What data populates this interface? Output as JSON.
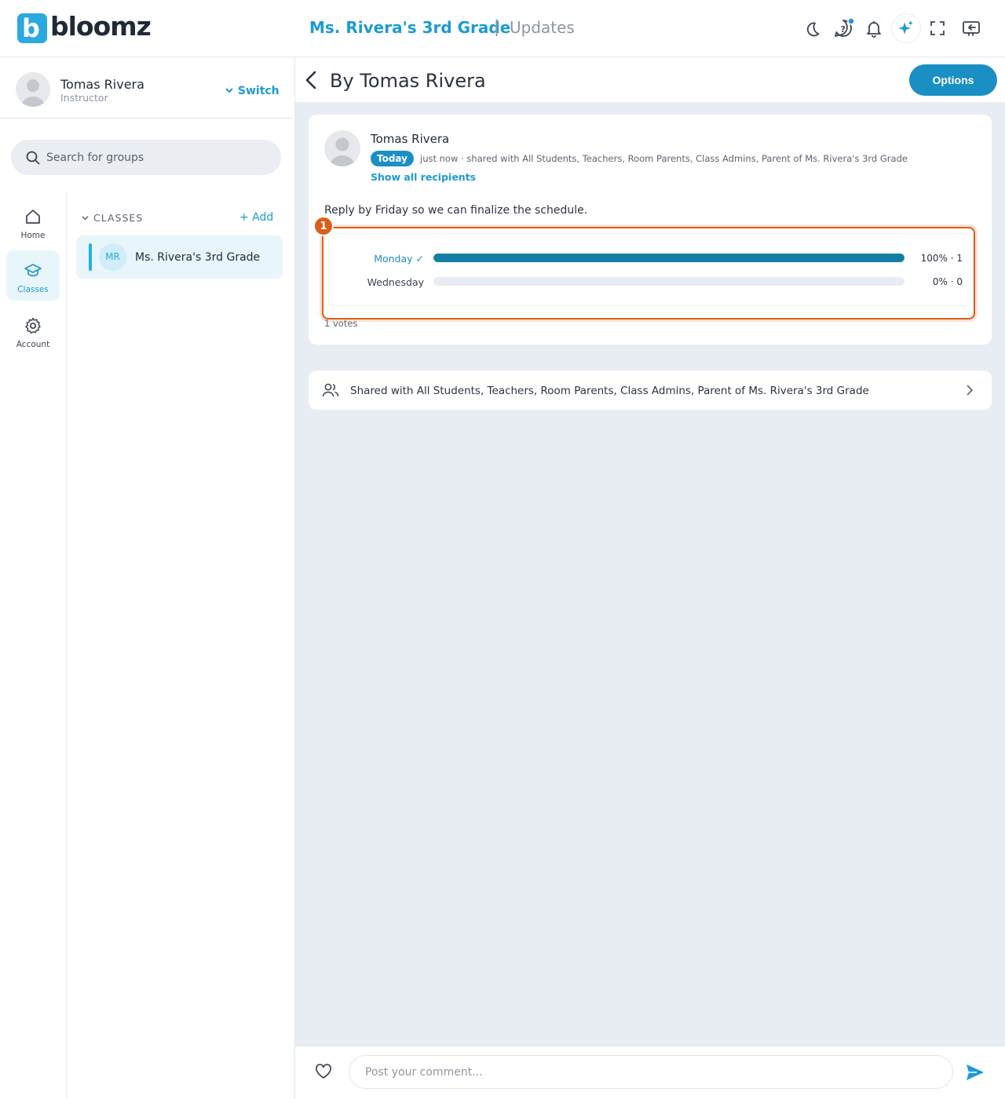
{
  "brand": {
    "logo_letter": "b",
    "name": "bloomz"
  },
  "header": {
    "class_title": "Ms. Rivera's 3rd Grade",
    "separator": "|",
    "section": "Updates",
    "accent_color": "#1c9bd1"
  },
  "user": {
    "name": "Tomas Rivera",
    "role": "Instructor",
    "switch_label": "Switch"
  },
  "search": {
    "placeholder": "Search for groups"
  },
  "nav": [
    {
      "label": "Home",
      "icon": "home-icon"
    },
    {
      "label": "Classes",
      "icon": "graduation-cap-icon",
      "active": true
    },
    {
      "label": "Account",
      "icon": "gear-icon"
    }
  ],
  "classes": {
    "heading": "CLASSES",
    "add_label": "+ Add",
    "items": [
      {
        "initials": "MR",
        "name": "Ms. Rivera's 3rd Grade"
      }
    ]
  },
  "page": {
    "title": "By Tomas Rivera",
    "options_label": "Options"
  },
  "post": {
    "author": "Tomas Rivera",
    "badge": "Today",
    "meta": "just now · shared with All Students, Teachers, Room Parents, Class Admins, Parent of Ms. Rivera's 3rd Grade",
    "show_all": "Show all recipients",
    "message": "Reply by Friday so we can finalize the schedule.",
    "poll": {
      "options": [
        {
          "label": "Monday ✓",
          "percent": 100,
          "pct_text": "100% · 1",
          "selected": true
        },
        {
          "label": "Wednesday",
          "percent": 0,
          "pct_text": "0% · 0",
          "selected": false
        }
      ],
      "votes_text": "1 votes"
    },
    "highlight_badge": "1"
  },
  "shared": {
    "text": "Shared with All Students, Teachers, Room Parents, Class Admins, Parent of Ms. Rivera's 3rd Grade"
  },
  "comment": {
    "placeholder": "Post your comment..."
  }
}
